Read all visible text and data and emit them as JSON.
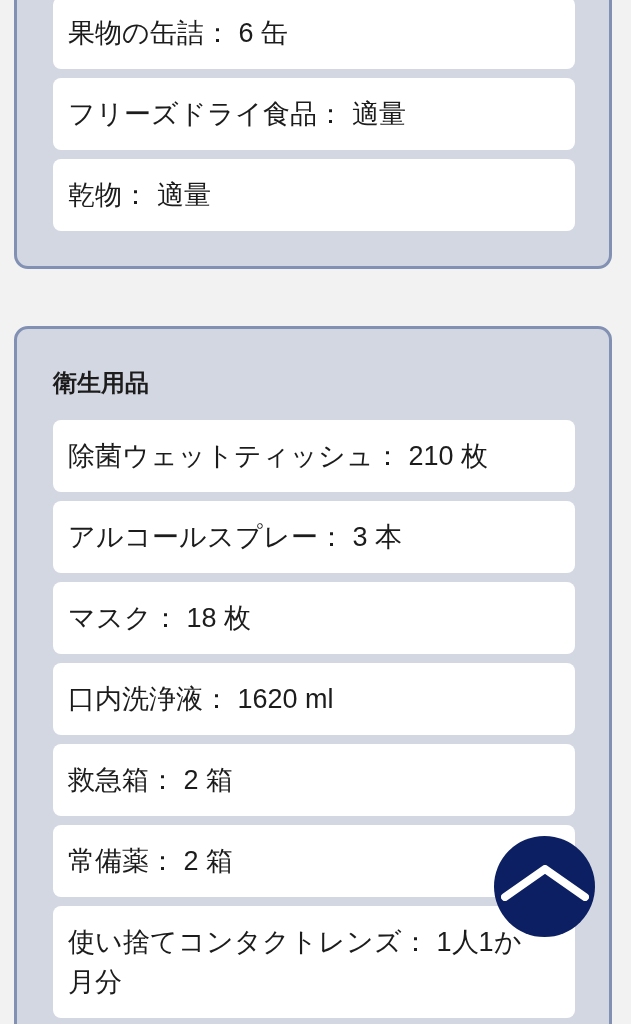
{
  "sections": [
    {
      "items": [
        {
          "text": "果物の缶詰： 6 缶"
        },
        {
          "text": "フリーズドライ食品： 適量"
        },
        {
          "text": "乾物： 適量"
        }
      ]
    },
    {
      "title": "衛生用品",
      "items": [
        {
          "text": "除菌ウェットティッシュ： 210 枚"
        },
        {
          "text": "アルコールスプレー： 3 本"
        },
        {
          "text": "マスク： 18 枚"
        },
        {
          "text": "口内洗浄液： 1620 ml"
        },
        {
          "text": "救急箱： 2 箱"
        },
        {
          "text": "常備薬： 2 箱"
        },
        {
          "text": "使い捨てコンタクトレンズ： 1人1か月分"
        }
      ]
    }
  ]
}
